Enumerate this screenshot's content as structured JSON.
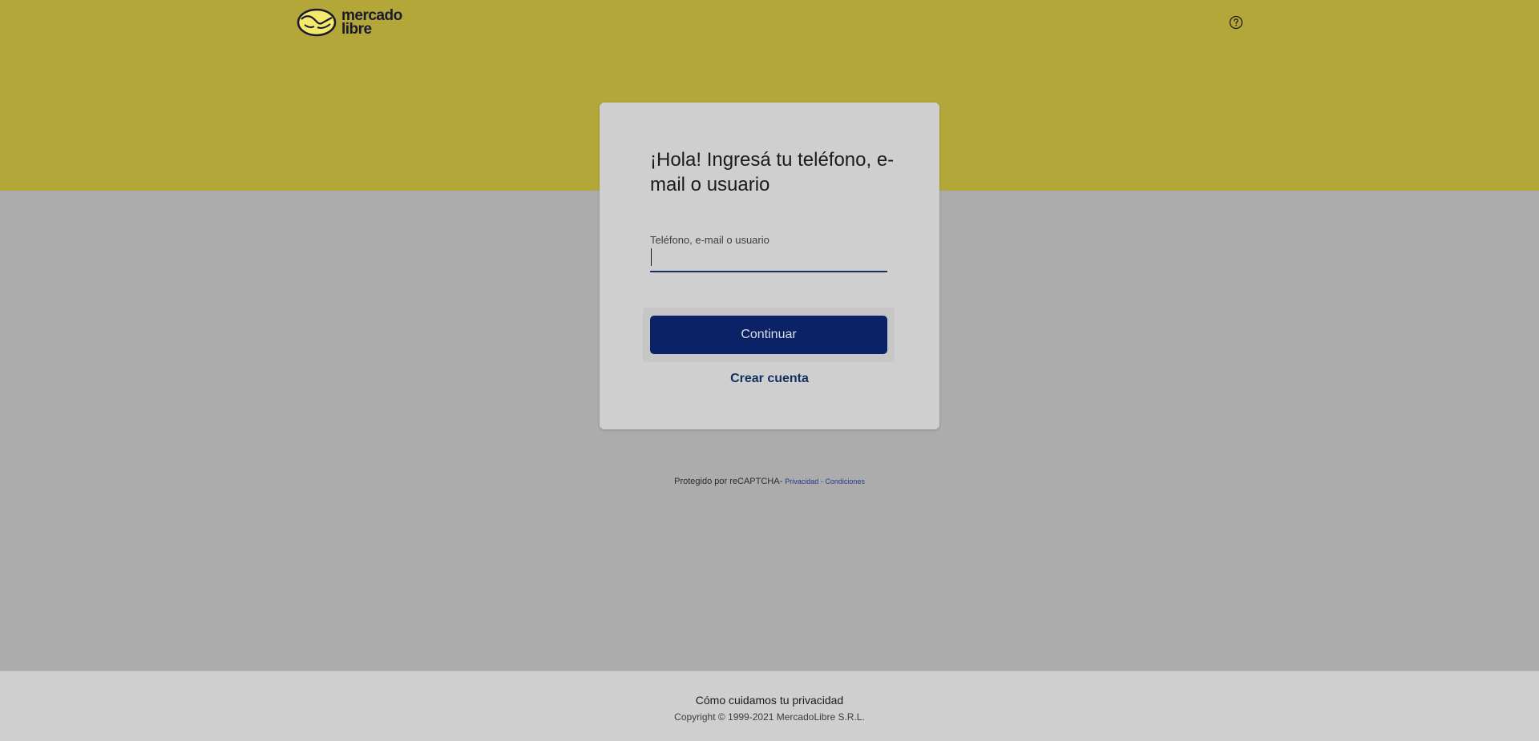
{
  "header": {
    "brand_line1": "mercado",
    "brand_line2": "libre",
    "help_icon": "question-circle-icon"
  },
  "login": {
    "title": "¡Hola! Ingresá tu teléfono, e-mail o usuario",
    "field_label": "Teléfono, e-mail o usuario",
    "field_value": "",
    "continue_label": "Continuar",
    "create_account_label": "Crear cuenta"
  },
  "recaptcha": {
    "text": "Protegido por reCAPTCHA-",
    "privacy_label": "Privacidad",
    "separator": " - ",
    "terms_label": "Condiciones"
  },
  "footer": {
    "privacy_label": "Cómo cuidamos tu privacidad",
    "copyright": "Copyright © 1999-2021 MercadoLibre S.R.L."
  },
  "colors": {
    "header_band": "#b3a73a",
    "page_bg": "#acacac",
    "card_bg": "#cfcfcf",
    "primary_button": "#0b2266",
    "link": "#12305e"
  }
}
